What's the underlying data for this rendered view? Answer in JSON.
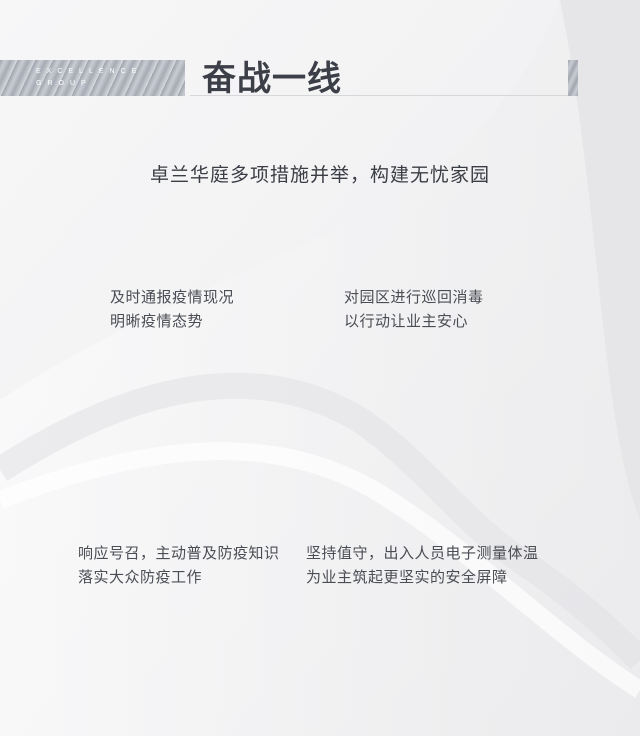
{
  "header": {
    "tag_line1": "EXCELLENCE",
    "tag_line2": "GROUP",
    "title": "奋战一线"
  },
  "subtitle": "卓兰华庭多项措施并举，构建无忧家园",
  "measures": [
    {
      "line1": "及时通报疫情现况",
      "line2": "明晰疫情态势"
    },
    {
      "line1": "对园区进行巡回消毒",
      "line2": "以行动让业主安心"
    },
    {
      "line1": "响应号召，主动普及防疫知识",
      "line2": "落实大众防疫工作"
    },
    {
      "line1": "坚持值守，出入人员电子测量体温",
      "line2": "为业主筑起更坚实的安全屏障"
    }
  ],
  "colors": {
    "background": "#f3f3f4",
    "title": "#3c3f47",
    "text": "#4a4d54",
    "accent_band": "#a6abb4"
  }
}
